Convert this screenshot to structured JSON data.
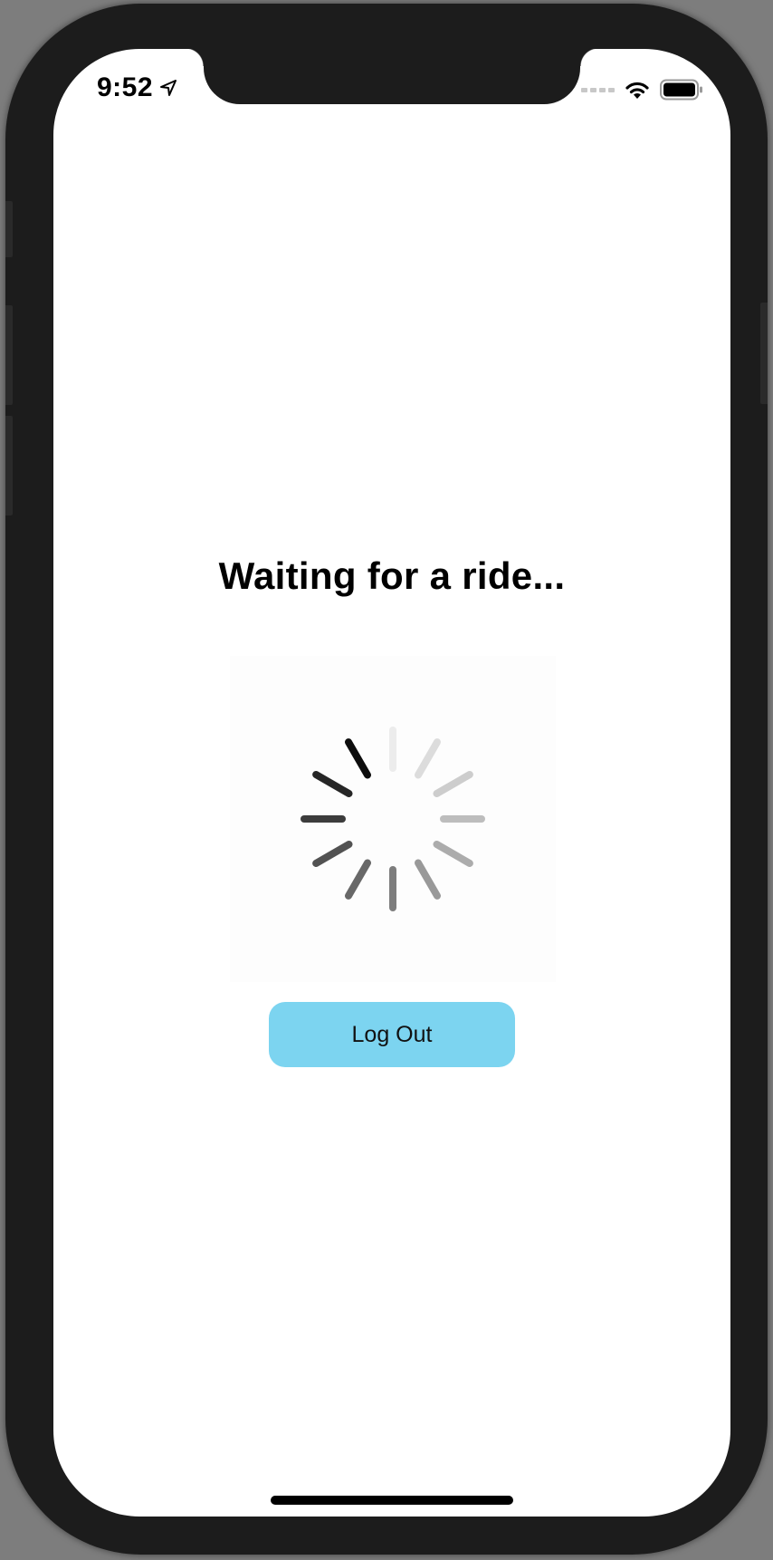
{
  "status_bar": {
    "time": "9:52",
    "location_icon": "location-arrow-icon",
    "signal_icon": "cellular-signal-icon",
    "wifi_icon": "wifi-icon",
    "battery_icon": "battery-icon"
  },
  "main": {
    "title": "Waiting for a ride...",
    "spinner_icon": "activity-spinner-icon",
    "logout_label": "Log Out",
    "logout_color": "#7cd4f0"
  }
}
